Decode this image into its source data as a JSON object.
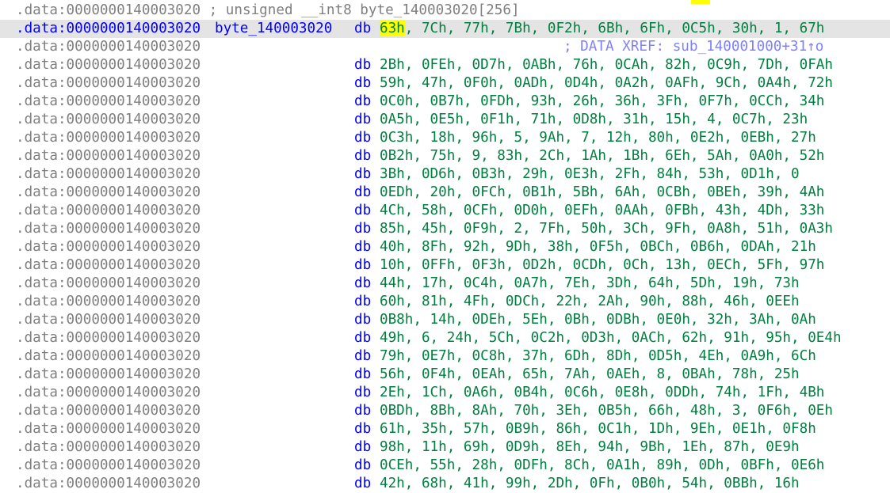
{
  "header": {
    "text": ".data:0000000140003020 ; unsigned __int8 byte_140003020[256]"
  },
  "selected_line": {
    "address": ".data:0000000140003020",
    "label": "byte_140003020",
    "mnemonic": "db",
    "first_operand": "63h",
    "rest_operands": ", 7Ch, 77h, 7Bh, 0F2h, 6Bh, 6Fh, 0C5h, 30h, 1, 67h"
  },
  "xref_line": {
    "address": ".data:0000000140003020",
    "comment": "; DATA XREF: sub_140001000+31↑o"
  },
  "rows": [
    {
      "address": ".data:0000000140003020",
      "mnemonic": "db",
      "operands": "2Bh, 0FEh, 0D7h, 0ABh, 76h, 0CAh, 82h, 0C9h, 7Dh, 0FAh"
    },
    {
      "address": ".data:0000000140003020",
      "mnemonic": "db",
      "operands": "59h, 47h, 0F0h, 0ADh, 0D4h, 0A2h, 0AFh, 9Ch, 0A4h, 72h"
    },
    {
      "address": ".data:0000000140003020",
      "mnemonic": "db",
      "operands": "0C0h, 0B7h, 0FDh, 93h, 26h, 36h, 3Fh, 0F7h, 0CCh, 34h"
    },
    {
      "address": ".data:0000000140003020",
      "mnemonic": "db",
      "operands": "0A5h, 0E5h, 0F1h, 71h, 0D8h, 31h, 15h, 4, 0C7h, 23h"
    },
    {
      "address": ".data:0000000140003020",
      "mnemonic": "db",
      "operands": "0C3h, 18h, 96h, 5, 9Ah, 7, 12h, 80h, 0E2h, 0EBh, 27h"
    },
    {
      "address": ".data:0000000140003020",
      "mnemonic": "db",
      "operands": "0B2h, 75h, 9, 83h, 2Ch, 1Ah, 1Bh, 6Eh, 5Ah, 0A0h, 52h"
    },
    {
      "address": ".data:0000000140003020",
      "mnemonic": "db",
      "operands": "3Bh, 0D6h, 0B3h, 29h, 0E3h, 2Fh, 84h, 53h, 0D1h, 0"
    },
    {
      "address": ".data:0000000140003020",
      "mnemonic": "db",
      "operands": "0EDh, 20h, 0FCh, 0B1h, 5Bh, 6Ah, 0CBh, 0BEh, 39h, 4Ah"
    },
    {
      "address": ".data:0000000140003020",
      "mnemonic": "db",
      "operands": "4Ch, 58h, 0CFh, 0D0h, 0EFh, 0AAh, 0FBh, 43h, 4Dh, 33h"
    },
    {
      "address": ".data:0000000140003020",
      "mnemonic": "db",
      "operands": "85h, 45h, 0F9h, 2, 7Fh, 50h, 3Ch, 9Fh, 0A8h, 51h, 0A3h"
    },
    {
      "address": ".data:0000000140003020",
      "mnemonic": "db",
      "operands": "40h, 8Fh, 92h, 9Dh, 38h, 0F5h, 0BCh, 0B6h, 0DAh, 21h"
    },
    {
      "address": ".data:0000000140003020",
      "mnemonic": "db",
      "operands": "10h, 0FFh, 0F3h, 0D2h, 0CDh, 0Ch, 13h, 0ECh, 5Fh, 97h"
    },
    {
      "address": ".data:0000000140003020",
      "mnemonic": "db",
      "operands": "44h, 17h, 0C4h, 0A7h, 7Eh, 3Dh, 64h, 5Dh, 19h, 73h"
    },
    {
      "address": ".data:0000000140003020",
      "mnemonic": "db",
      "operands": "60h, 81h, 4Fh, 0DCh, 22h, 2Ah, 90h, 88h, 46h, 0EEh"
    },
    {
      "address": ".data:0000000140003020",
      "mnemonic": "db",
      "operands": "0B8h, 14h, 0DEh, 5Eh, 0Bh, 0DBh, 0E0h, 32h, 3Ah, 0Ah"
    },
    {
      "address": ".data:0000000140003020",
      "mnemonic": "db",
      "operands": "49h, 6, 24h, 5Ch, 0C2h, 0D3h, 0ACh, 62h, 91h, 95h, 0E4h"
    },
    {
      "address": ".data:0000000140003020",
      "mnemonic": "db",
      "operands": "79h, 0E7h, 0C8h, 37h, 6Dh, 8Dh, 0D5h, 4Eh, 0A9h, 6Ch"
    },
    {
      "address": ".data:0000000140003020",
      "mnemonic": "db",
      "operands": "56h, 0F4h, 0EAh, 65h, 7Ah, 0AEh, 8, 0BAh, 78h, 25h"
    },
    {
      "address": ".data:0000000140003020",
      "mnemonic": "db",
      "operands": "2Eh, 1Ch, 0A6h, 0B4h, 0C6h, 0E8h, 0DDh, 74h, 1Fh, 4Bh"
    },
    {
      "address": ".data:0000000140003020",
      "mnemonic": "db",
      "operands": "0BDh, 8Bh, 8Ah, 70h, 3Eh, 0B5h, 66h, 48h, 3, 0F6h, 0Eh"
    },
    {
      "address": ".data:0000000140003020",
      "mnemonic": "db",
      "operands": "61h, 35h, 57h, 0B9h, 86h, 0C1h, 1Dh, 9Eh, 0E1h, 0F8h"
    },
    {
      "address": ".data:0000000140003020",
      "mnemonic": "db",
      "operands": "98h, 11h, 69h, 0D9h, 8Eh, 94h, 9Bh, 1Eh, 87h, 0E9h"
    },
    {
      "address": ".data:0000000140003020",
      "mnemonic": "db",
      "operands": "0CEh, 55h, 28h, 0DFh, 8Ch, 0A1h, 89h, 0Dh, 0BFh, 0E6h"
    },
    {
      "address": ".data:0000000140003020",
      "mnemonic": "db",
      "operands": "42h, 68h, 41h, 99h, 2Dh, 0Fh, 0B0h, 54h, 0BBh, 16h"
    }
  ],
  "colors": {
    "address": "#808080",
    "keyword": "#0000ff",
    "operand": "#008040",
    "xref": "#8080ff",
    "highlight": "#ffff00",
    "selection": "#e4e4e4"
  }
}
